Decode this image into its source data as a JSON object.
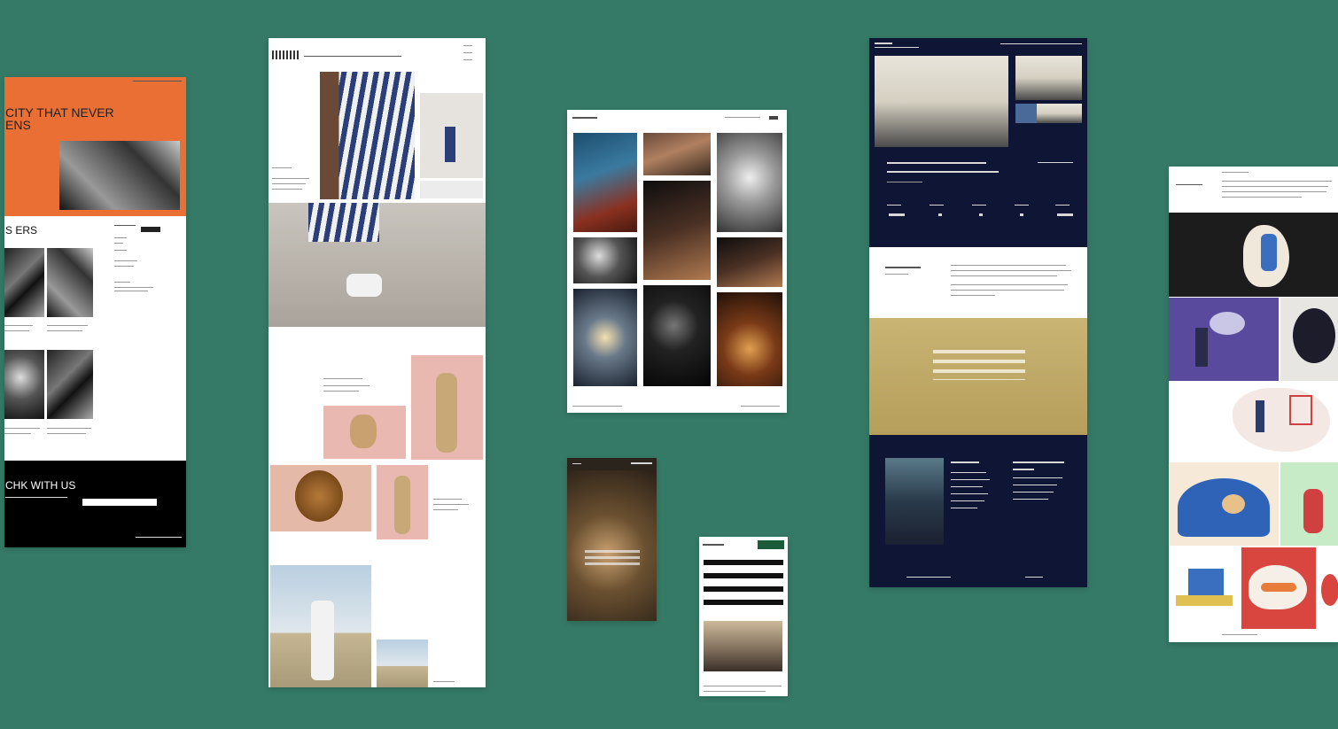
{
  "canvas": {
    "background": "#357a66"
  },
  "card1": {
    "accent": "#e96f35",
    "headline": "CITY THAT NEVER\nENS",
    "section_heading": "S  ERS",
    "cta_heading": "CHK WITH US"
  },
  "card6": {
    "accent": "#0f1535"
  },
  "card7": {
    "accent": "#1a5c3a"
  }
}
